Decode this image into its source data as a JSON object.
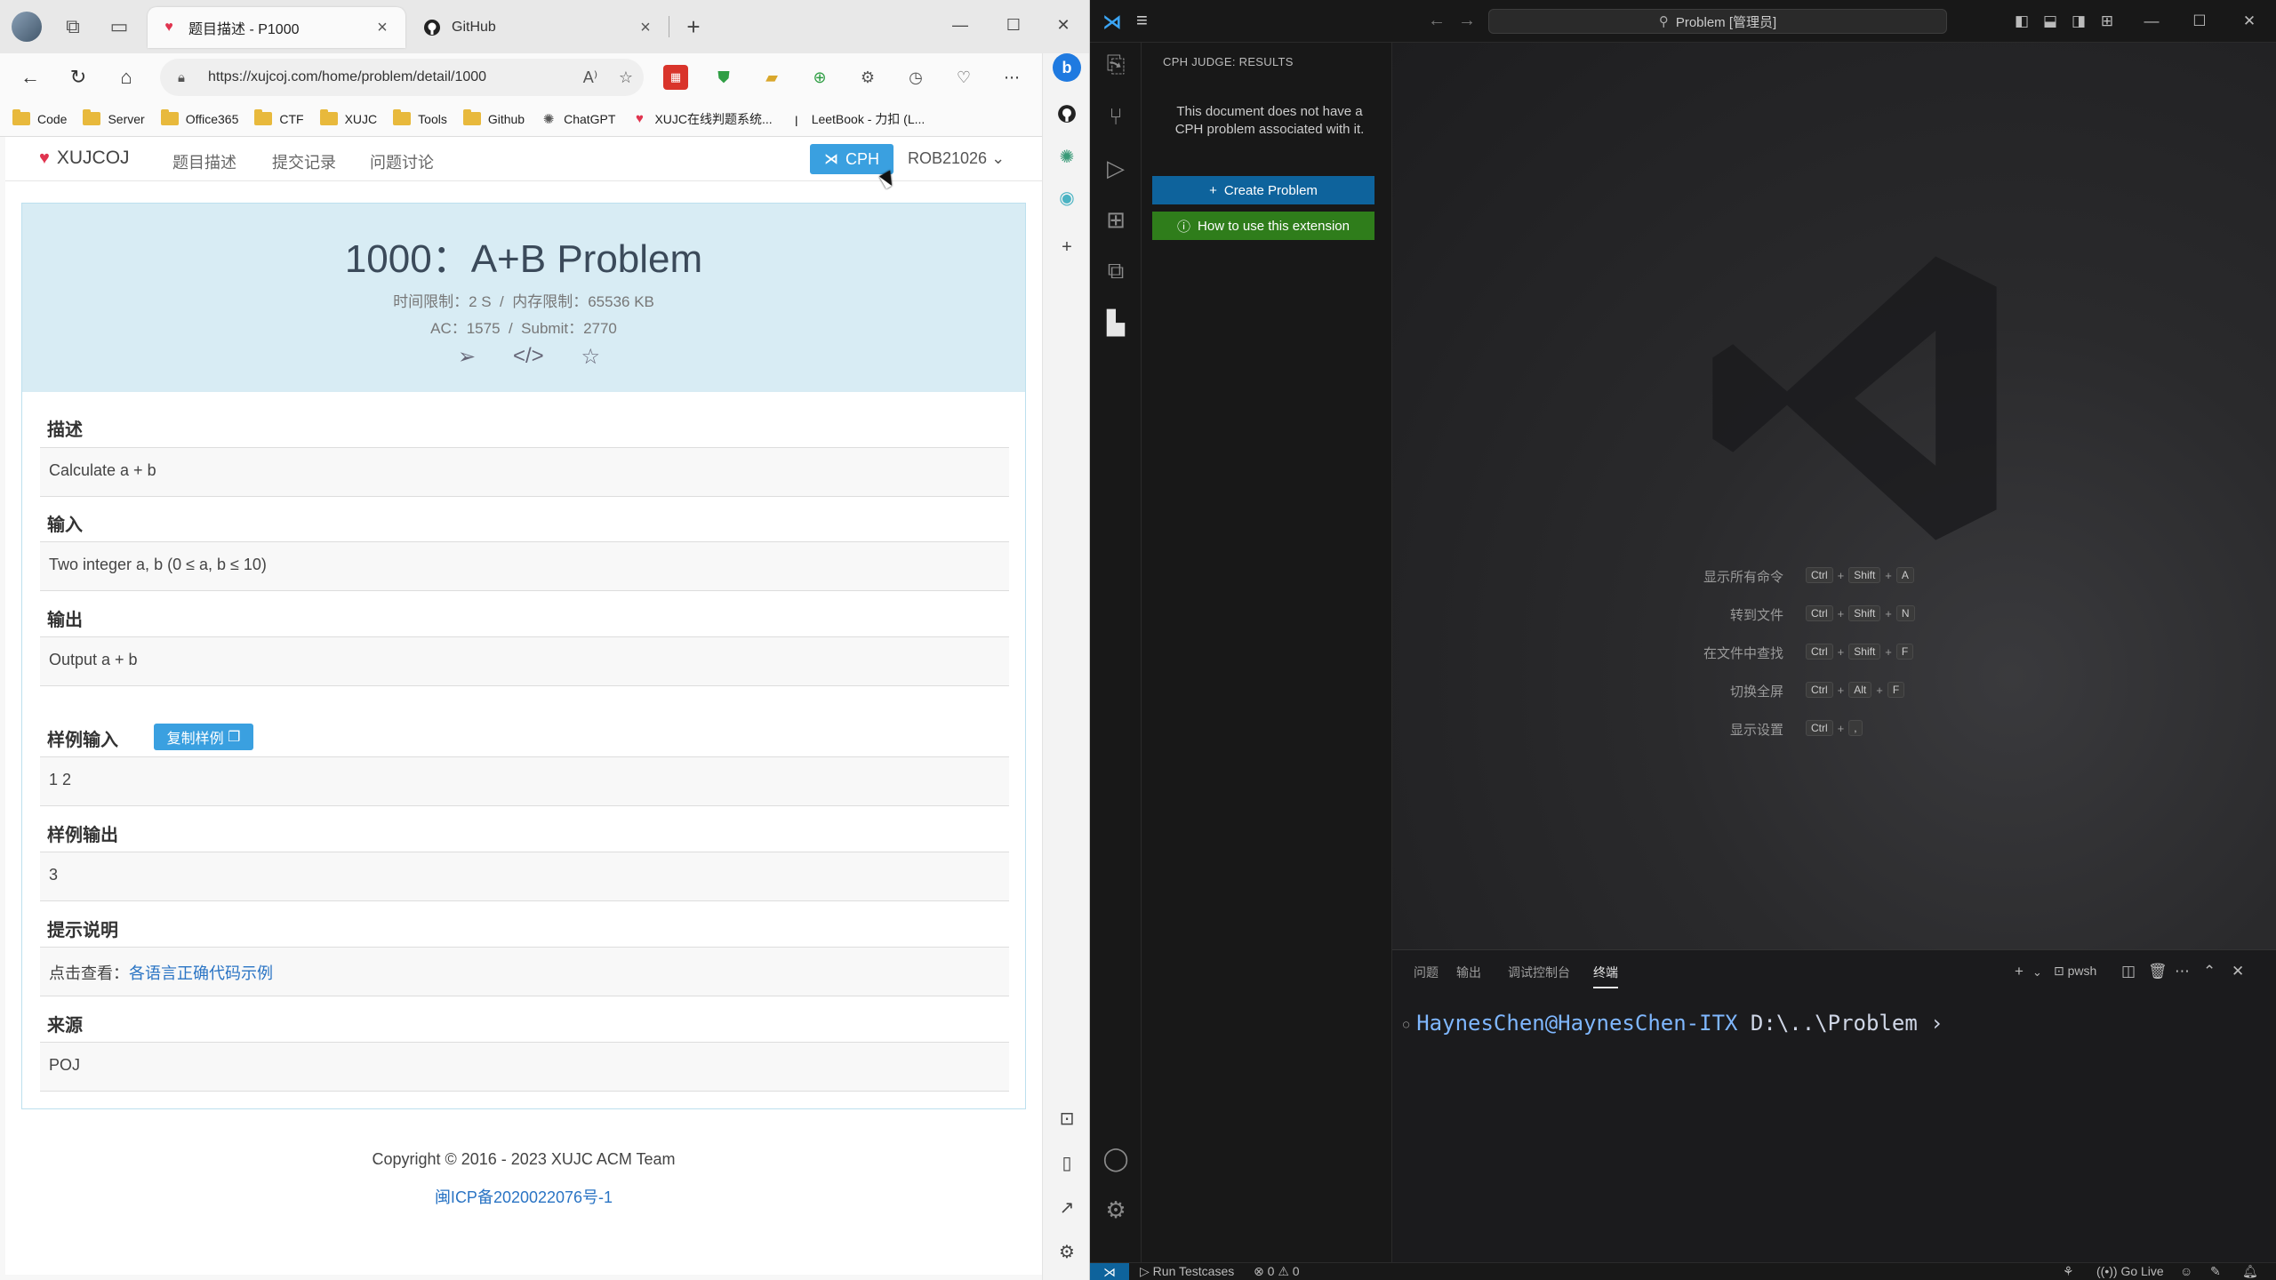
{
  "browser": {
    "tabs": [
      {
        "title": "题目描述 - P1000",
        "active": true
      },
      {
        "title": "GitHub",
        "active": false
      }
    ],
    "url": "https://xujcoj.com/home/problem/detail/1000",
    "bookmarks": [
      "Code",
      "Server",
      "Office365",
      "CTF",
      "XUJC",
      "Tools",
      "Github",
      "ChatGPT",
      "XUJC在线判题系统...",
      "LeetBook - 力扣 (L..."
    ]
  },
  "site": {
    "brand": "XUJCOJ",
    "nav": [
      "题目描述",
      "提交记录",
      "问题讨论"
    ],
    "cph_label": "CPH",
    "user": "ROB21026"
  },
  "problem": {
    "title": "1000：A+B Problem",
    "limits": "时间限制：2 S  /  内存限制：65536 KB",
    "stats": "AC：1575  /  Submit：2770",
    "sections": [
      {
        "heading": "描述",
        "content": "Calculate a + b"
      },
      {
        "heading": "输入",
        "content": "Two integer a, b (0 ≤ a, b ≤ 10)"
      },
      {
        "heading": "输出",
        "content": "Output a + b"
      },
      {
        "heading": "样例输入",
        "content": "1 2"
      },
      {
        "heading": "样例输出",
        "content": "3"
      },
      {
        "heading": "提示说明",
        "content_prefix": "点击查看：",
        "content_link": "各语言正确代码示例"
      },
      {
        "heading": "来源",
        "content": "POJ"
      }
    ],
    "copy_label": "复制样例"
  },
  "footer": {
    "copyright": "Copyright © 2016 - 2023 XUJC ACM Team",
    "icp": "闽ICP备2020022076号-1"
  },
  "vscode": {
    "command_center": "Problem [管理员]",
    "sidebar_title": "CPH JUDGE: RESULTS",
    "sidebar_msg": "This document does not have a CPH problem associated with it.",
    "create_btn": "Create Problem",
    "howto_btn": "How to use this extension",
    "shortcuts": [
      {
        "label": "显示所有命令",
        "keys": [
          "Ctrl",
          "Shift",
          "A"
        ]
      },
      {
        "label": "转到文件",
        "keys": [
          "Ctrl",
          "Shift",
          "N"
        ]
      },
      {
        "label": "在文件中查找",
        "keys": [
          "Ctrl",
          "Shift",
          "F"
        ]
      },
      {
        "label": "切换全屏",
        "keys": [
          "Ctrl",
          "Alt",
          "F"
        ]
      },
      {
        "label": "显示设置",
        "keys": [
          "Ctrl",
          ","
        ]
      }
    ],
    "panel_tabs": [
      "问题",
      "输出",
      "调试控制台",
      "终端"
    ],
    "terminal_shell": "pwsh",
    "terminal_user": "HaynesChen@HaynesChen-ITX",
    "terminal_path": "D:\\..\\Problem",
    "status": {
      "run": "Run Testcases",
      "errors": "0",
      "warnings": "0",
      "golive": "Go Live"
    }
  }
}
